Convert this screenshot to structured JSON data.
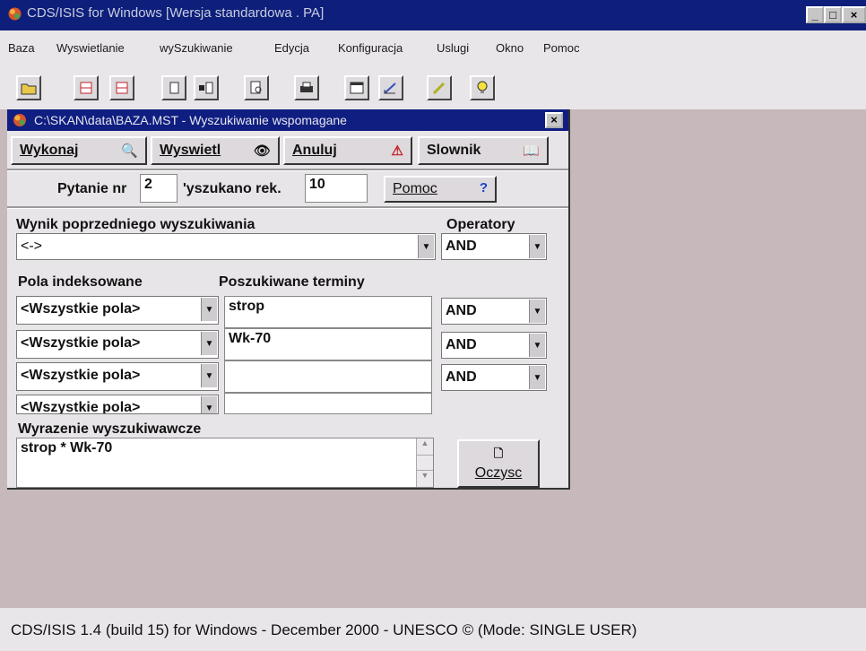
{
  "window": {
    "title": "CDS/ISIS for Windows [Wersja standardowa . PA]",
    "controls": [
      "_",
      "□",
      "×"
    ]
  },
  "menu": [
    "Baza",
    "Wyswietlanie",
    "wySzukiwanie",
    "Edycja",
    "Konfiguracja",
    "Uslugi",
    "Okno",
    "Pomoc"
  ],
  "toolbar": {
    "icons": [
      "open-folder-icon",
      "print-db-icon",
      "print-db-2-icon",
      "document-icon",
      "records-icon",
      "preview-icon",
      "printer-icon",
      "form-icon",
      "edit-brush-icon",
      "pencil-icon",
      "lightbulb-icon"
    ]
  },
  "dialog": {
    "title": "C:\\SKAN\\data\\BAZA.MST - Wyszukiwanie wspomagane",
    "close": "×",
    "buttons": {
      "execute": "Wykonaj",
      "display": "Wyswietl",
      "cancel": "Anuluj",
      "dictionary": "Slownik"
    },
    "query_label": "Pytanie nr",
    "query_number": "2",
    "found_label": "'yszukano rek.",
    "found_count": "10",
    "help": "Pomoc",
    "help_mark": "?",
    "previous_result_label": "Wynik poprzedniego wyszukiwania",
    "previous_result_value": "<->",
    "operators_label": "Operatory",
    "operator_top": "AND",
    "fields_label": "Pola indeksowane",
    "terms_label": "Poszukiwane terminy",
    "rows": [
      {
        "field": "<Wszystkie pola>",
        "term": "strop",
        "operator": "AND"
      },
      {
        "field": "<Wszystkie pola>",
        "term": "Wk-70",
        "operator": "AND"
      },
      {
        "field": "<Wszystkie pola>",
        "term": "",
        "operator": "AND"
      },
      {
        "field": "<Wszystkie pola>",
        "term": "",
        "operator": ""
      }
    ],
    "expression_label": "Wyrazenie wyszukiwawcze",
    "expression_value": "strop * Wk-70",
    "clear": "Oczysc"
  },
  "status": "CDS/ISIS 1.4 (build 15) for Windows - December 2000 - UNESCO © (Mode: SINGLE USER)"
}
